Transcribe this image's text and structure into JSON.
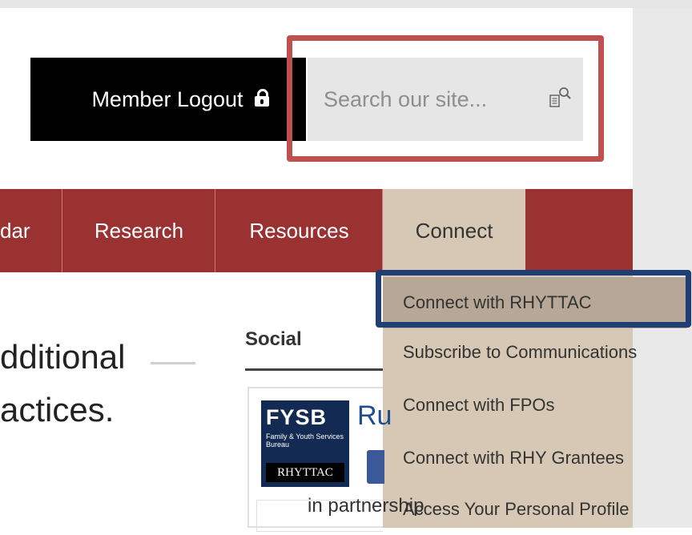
{
  "header": {
    "member_logout_label": "Member Logout",
    "search_placeholder": "Search our site..."
  },
  "nav": {
    "items": [
      {
        "label": "dar"
      },
      {
        "label": "Research"
      },
      {
        "label": "Resources"
      },
      {
        "label": "Connect"
      }
    ]
  },
  "connect_menu": {
    "items": [
      {
        "label": "Connect with RHYTTAC"
      },
      {
        "label": "Subscribe to Communications"
      },
      {
        "label": "Connect with FPOs"
      },
      {
        "label": "Connect with RHY Grantees"
      },
      {
        "label": "Access Your Personal Profile"
      }
    ]
  },
  "content": {
    "line1": "dditional",
    "line2": "actices.",
    "footer_line": "in partnership"
  },
  "social": {
    "title": "Social",
    "logo_main": "FYSB",
    "logo_sub": "Family & Youth Services Bureau",
    "logo_band": "RHYTTAC",
    "page_name": "Ru"
  },
  "colors": {
    "nav_bg": "#9b3232",
    "dropdown_bg": "#d6c8b4",
    "active_item_bg": "#b7a796",
    "red_highlight": "#c0504d",
    "blue_highlight": "#1f3f74"
  },
  "icons": {
    "lock": "lock-icon",
    "search": "search-document-icon"
  }
}
